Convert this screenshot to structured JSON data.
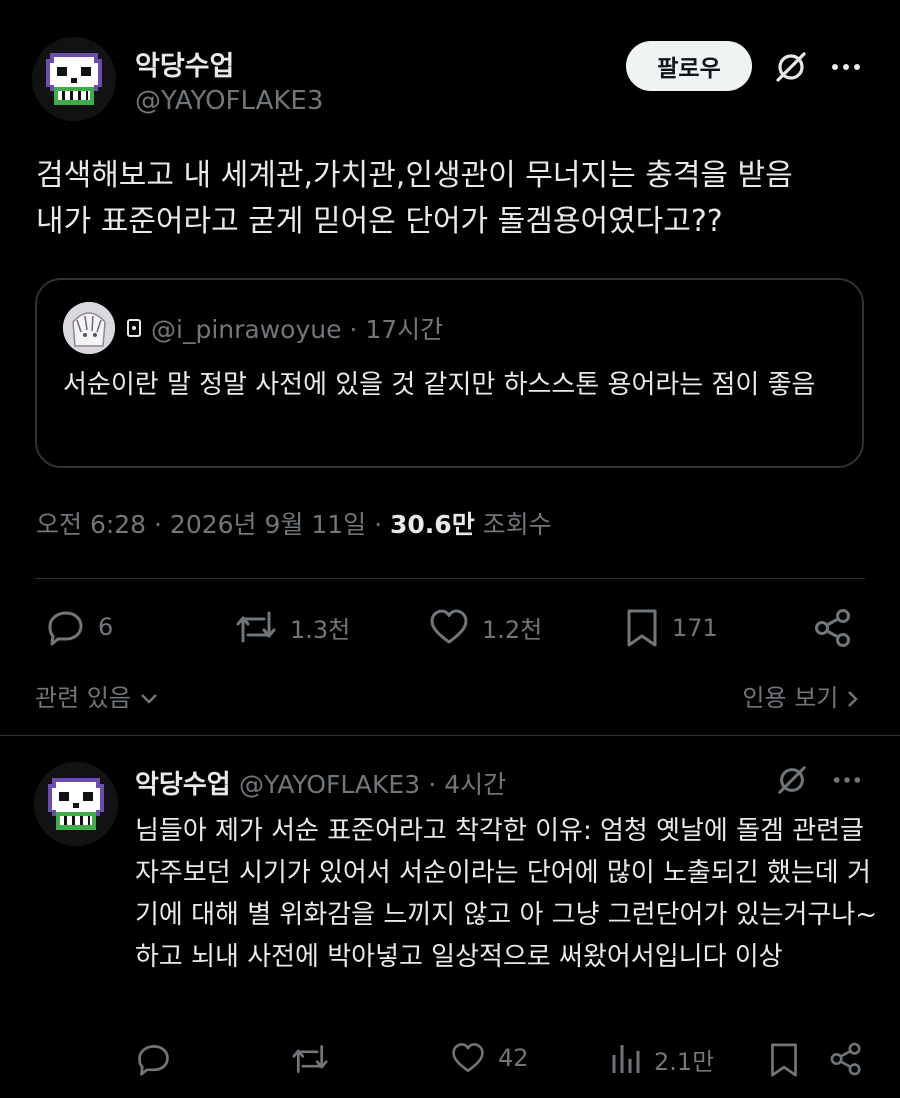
{
  "post": {
    "author_name": "악당수업",
    "author_handle": "@YAYOFLAKE3",
    "follow_label": "팔로우",
    "text_line1": "검색해보고 내 세계관,가치관,인생관이 무너지는 충격을 받음",
    "text_line2": "내가 표준어라고 굳게 믿어온 단어가 돌겜용어였다고??",
    "quote": {
      "handle": "@i_pinrawoyue",
      "time": "· 17시간",
      "text": "서순이란 말 정말 사전에 있을 것 같지만 하스스톤 용어라는 점이 좋음"
    },
    "timestamp": "오전 6:28 · 2026년 9월 11일 ·",
    "views_count": "30.6만",
    "views_label": "조회수",
    "stats": {
      "replies": "6",
      "reposts": "1.3천",
      "likes": "1.2천",
      "bookmarks": "171"
    },
    "related_label": "관련 있음",
    "quotes_label": "인용 보기"
  },
  "reply": {
    "author_name": "악당수업",
    "author_handle": "@YAYOFLAKE3",
    "time": "· 4시간",
    "text": "님들아 제가 서순 표준어라고 착각한 이유: 엄청 옛날에 돌겜 관련글 자주보던 시기가 있어서 서순이라는 단어에 많이 노출되긴 했는데 거기에 대해 별 위화감을 느끼지 않고 아 그냥 그런단어가 있는거구나~ 하고 뇌내 사전에 박아넣고 일상적으로 써왔어서입니다 이상",
    "stats": {
      "likes": "42",
      "views": "2.1만"
    }
  },
  "colors": {
    "background": "#000000",
    "text": "#e7e9ea",
    "muted": "#71767b",
    "border": "#2f3336",
    "skull_purple": "#6d4bb0",
    "skull_green": "#3fae48"
  }
}
